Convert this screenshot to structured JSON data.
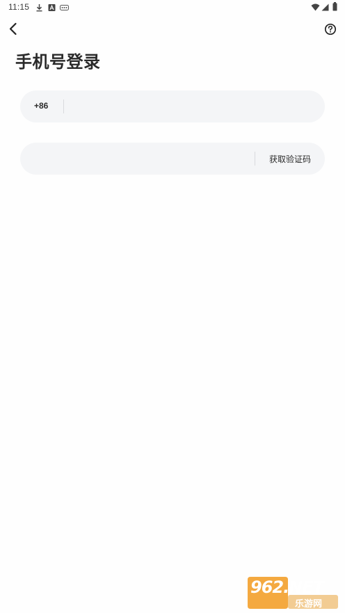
{
  "status_bar": {
    "time": "11:15",
    "left_icons": [
      "download-icon",
      "notification-a-icon",
      "game-controller-icon"
    ],
    "right_icons": [
      "wifi-icon",
      "cellular-signal-icon",
      "battery-icon"
    ]
  },
  "header": {
    "back_icon": "chevron-left-icon",
    "help_icon": "question-circle-icon",
    "title": "手机号登录"
  },
  "form": {
    "phone": {
      "country_code": "+86",
      "value": "",
      "placeholder": ""
    },
    "code": {
      "value": "",
      "placeholder": "",
      "get_code_label": "获取验证码"
    }
  },
  "watermark": {
    "brand": "962.NET",
    "subtitle": "乐游网"
  },
  "colors": {
    "background": "#fefefe",
    "field_bg": "#f4f5f7",
    "text": "#2a2a2a",
    "watermark_orange": "#f29a1f"
  }
}
